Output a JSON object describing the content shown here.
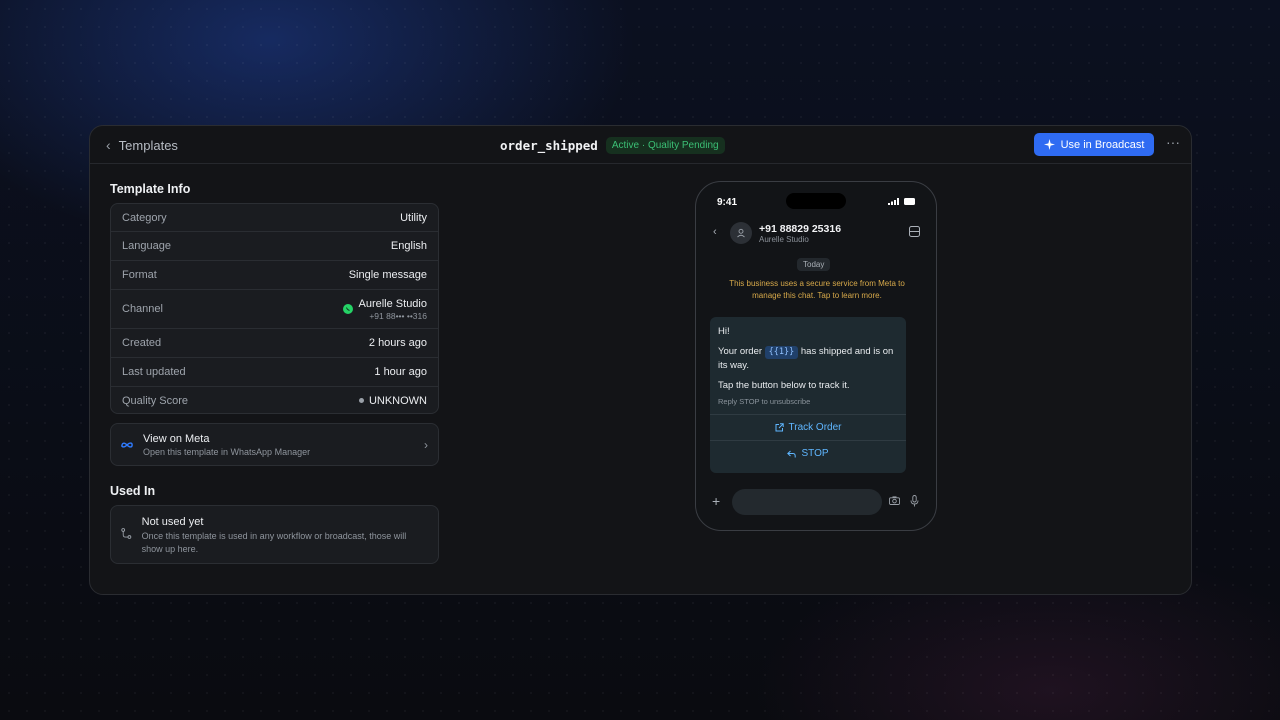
{
  "header": {
    "back_label": "Templates",
    "template_name": "order_shipped",
    "status": "Active · Quality Pending",
    "primary_action": "Use in Broadcast",
    "more_label": "···"
  },
  "template_info": {
    "title": "Template Info",
    "rows": [
      {
        "key": "Category",
        "value": "Utility"
      },
      {
        "key": "Language",
        "value": "English"
      },
      {
        "key": "Format",
        "value": "Single message"
      },
      {
        "key": "Channel",
        "value": "Aurelle Studio",
        "sub": "+91 88••• ••316"
      },
      {
        "key": "Created",
        "value": "2 hours ago"
      },
      {
        "key": "Last updated",
        "value": "1 hour ago"
      },
      {
        "key": "Quality Score",
        "value": "UNKNOWN"
      }
    ]
  },
  "meta_link": {
    "title": "View on Meta",
    "subtitle": "Open this template in WhatsApp Manager"
  },
  "used_in": {
    "title": "Used In",
    "empty_title": "Not used yet",
    "empty_desc": "Once this template is used in any workflow or broadcast, those will show up here."
  },
  "phone": {
    "time": "9:41",
    "contact_number": "+91 88829 25316",
    "contact_name": "Aurelle Studio",
    "date_chip": "Today",
    "security_notice": "This business uses a secure service from Meta to manage this chat. Tap to learn more.",
    "message": {
      "greeting": "Hi!",
      "line1_pre": "Your order",
      "variable": "{{1}}",
      "line1_post": "has shipped and is on its way.",
      "line2": "Tap the button below to track it.",
      "footer": "Reply STOP to unsubscribe"
    },
    "buttons": [
      "Track Order",
      "STOP"
    ]
  },
  "colors": {
    "accent": "#2f6bf2",
    "status_green": "#3bbf75",
    "whatsapp": "#25d366",
    "notice": "#d7a94a",
    "link": "#5fb6ff"
  }
}
